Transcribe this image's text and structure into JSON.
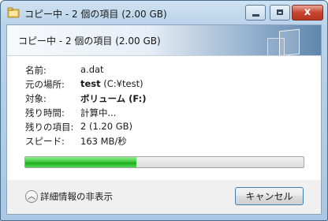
{
  "window": {
    "title": "コピー中 - 2 個の項目 (2.00 GB)",
    "controls": {
      "minimize_icon": "minimize-icon",
      "maximize_icon": "maximize-icon",
      "close_glyph": "x"
    }
  },
  "header": {
    "text": "コピー中 - 2 個の項目 (2.00 GB)"
  },
  "details": [
    {
      "label": "名前:",
      "value": "a.dat"
    },
    {
      "label": "元の場所:",
      "value_bold": "test",
      "value_rest": " (C:¥test)"
    },
    {
      "label": "対象:",
      "value_bold": "ボリューム (F:)"
    },
    {
      "label": "残り時間:",
      "value": "計算中..."
    },
    {
      "label": "残りの項目:",
      "value": "2 (1.20 GB)"
    },
    {
      "label": "スピード:",
      "value": "163 MB/秒"
    }
  ],
  "progress": {
    "fraction": 0.4,
    "color": "#3fcb3f"
  },
  "footer": {
    "toggle_label": "詳細情報の非表示",
    "toggle_icon": "chevron-up-icon",
    "cancel_label": "キャンセル"
  }
}
